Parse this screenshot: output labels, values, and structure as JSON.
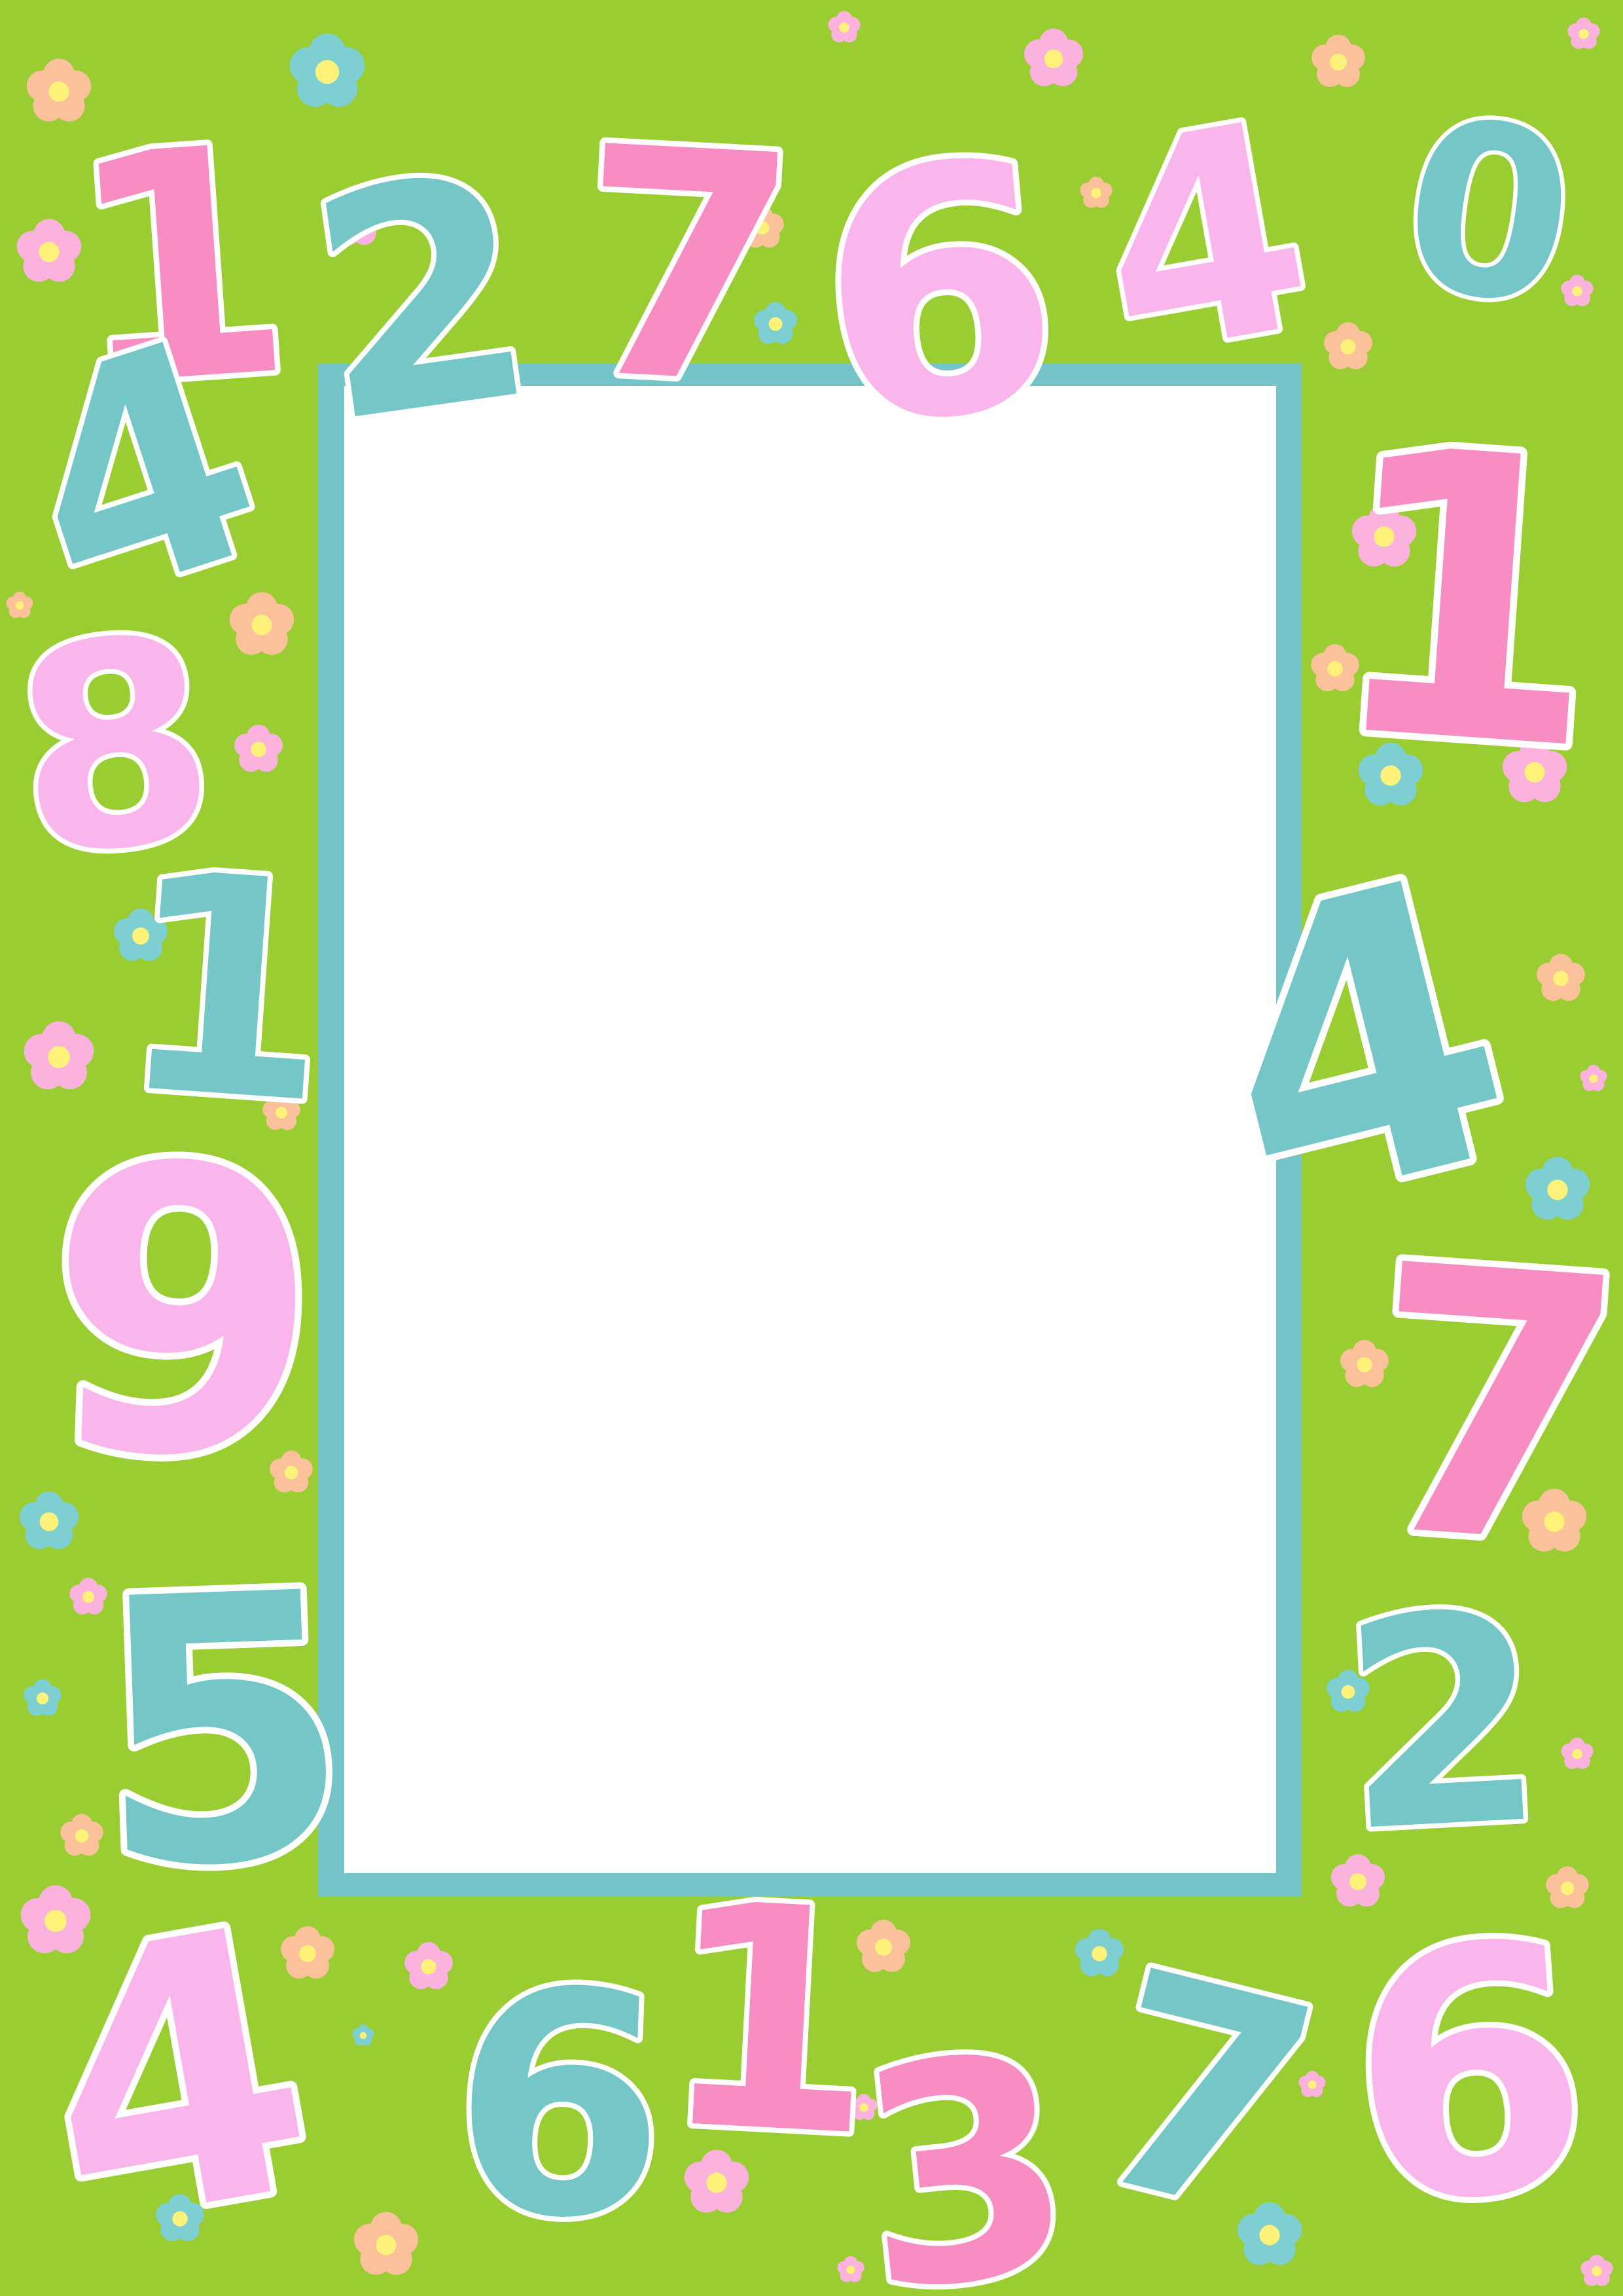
{
  "colors": {
    "background": "#9acd32",
    "frame_border": "#75c5c8",
    "frame_fill": "#ffffff",
    "digit_pink": "#f78dc3",
    "digit_light_pink": "#fab6ec",
    "digit_teal": "#75c7c7",
    "flower_pink": "#fbb3dd",
    "flower_peach": "#fbc19a",
    "flower_teal": "#7dcfd2",
    "flower_center": "#fff27a"
  },
  "icons": [
    "flower-icon"
  ],
  "digits": [
    {
      "char": "1",
      "color": "#f78dc3",
      "rotate": -4
    },
    {
      "char": "2",
      "color": "#75c7c7",
      "rotate": -8
    },
    {
      "char": "7",
      "color": "#f78dc3",
      "rotate": 3
    },
    {
      "char": "6",
      "color": "#fab6ec",
      "rotate": -5
    },
    {
      "char": "4",
      "color": "#fab6ec",
      "rotate": -10
    },
    {
      "char": "0",
      "color": "#75c7c7",
      "rotate": 8
    },
    {
      "char": "4",
      "color": "#75c7c7",
      "rotate": -18
    },
    {
      "char": "1",
      "color": "#f78dc3",
      "rotate": 4
    },
    {
      "char": "8",
      "color": "#fab6ec",
      "rotate": -6
    },
    {
      "char": "1",
      "color": "#75c7c7",
      "rotate": 4
    },
    {
      "char": "4",
      "color": "#75c7c7",
      "rotate": -14
    },
    {
      "char": "9",
      "color": "#fab6ec",
      "rotate": 2
    },
    {
      "char": "7",
      "color": "#f78dc3",
      "rotate": 4
    },
    {
      "char": "5",
      "color": "#75c7c7",
      "rotate": -2
    },
    {
      "char": "2",
      "color": "#75c7c7",
      "rotate": -3
    },
    {
      "char": "4",
      "color": "#fab6ec",
      "rotate": -10
    },
    {
      "char": "6",
      "color": "#75c7c7",
      "rotate": 2
    },
    {
      "char": "1",
      "color": "#f78dc3",
      "rotate": 3
    },
    {
      "char": "3",
      "color": "#f78dc3",
      "rotate": -6
    },
    {
      "char": "7",
      "color": "#75c7c7",
      "rotate": 14
    },
    {
      "char": "6",
      "color": "#fab6ec",
      "rotate": -4
    }
  ]
}
